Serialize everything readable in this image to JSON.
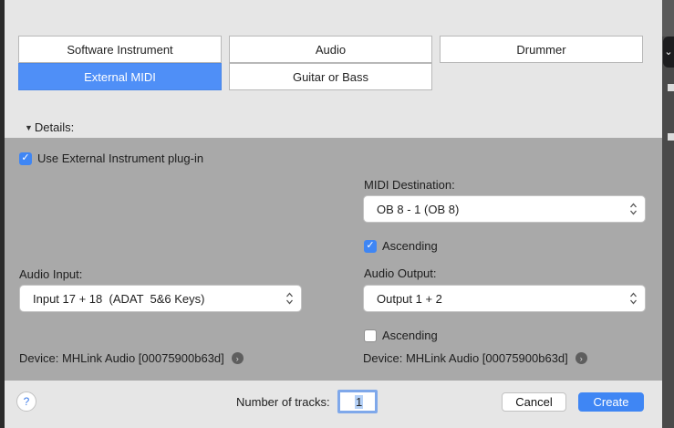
{
  "track_types": {
    "software_instrument": "Software Instrument",
    "audio": "Audio",
    "drummer": "Drummer",
    "external_midi": "External MIDI",
    "guitar_or_bass": "Guitar or Bass",
    "selected": "External MIDI"
  },
  "details": {
    "toggle_label": "Details:",
    "use_external_plugin": {
      "label": "Use External Instrument plug-in",
      "checked": true
    },
    "midi_destination": {
      "label": "MIDI Destination:",
      "value": "OB 8 - 1 (OB 8)",
      "ascending": {
        "label": "Ascending",
        "checked": true
      }
    },
    "audio_input": {
      "label": "Audio Input:",
      "value": "Input 17 + 18  (ADAT  5&6 Keys)",
      "device": "Device: MHLink Audio [00075900b63d]"
    },
    "audio_output": {
      "label": "Audio Output:",
      "value": "Output 1 + 2",
      "ascending": {
        "label": "Ascending",
        "checked": false
      },
      "device": "Device: MHLink Audio [00075900b63d]"
    }
  },
  "footer": {
    "help_label": "?",
    "tracks_label": "Number of tracks:",
    "tracks_value": "1",
    "cancel_label": "Cancel",
    "create_label": "Create"
  },
  "colors": {
    "accent": "#3f86f4",
    "selected_tab": "#4f8ff7",
    "details_bg": "#a9a9a9",
    "sheet_bg": "#e6e6e6"
  }
}
